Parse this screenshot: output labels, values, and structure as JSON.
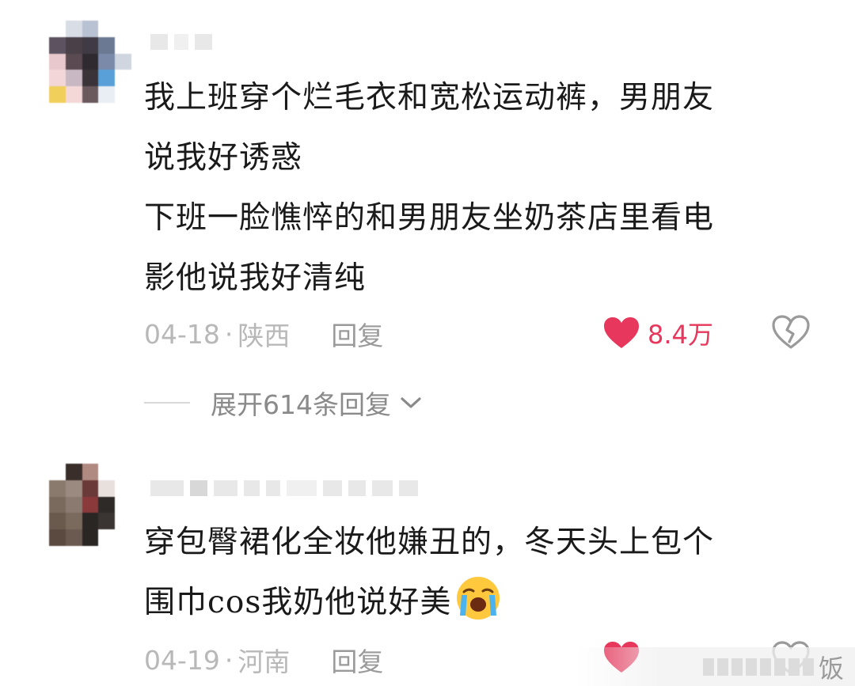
{
  "comments": [
    {
      "lines": [
        "我上班穿个烂毛衣和宽松运动裤，男朋友",
        "说我好诱惑",
        "下班一脸憔悴的和男朋友坐奶茶店里看电",
        "影他说我好清纯"
      ],
      "date": "04-18",
      "dot": "·",
      "location": "陕西",
      "reply_label": "回复",
      "like_count": "8.4万",
      "expand_label": "展开614条回复"
    },
    {
      "lines": [
        "穿包臀裙化全妆他嫌丑的，冬天头上包个",
        "围巾cos我奶他说好美"
      ],
      "emoji": "crying-face-emoji",
      "date": "04-19",
      "dot": "·",
      "location": "河南",
      "reply_label": "回复",
      "like_count": ""
    }
  ],
  "watermark": {
    "text": "饭"
  },
  "colors": {
    "like_red": "#e8375c",
    "meta_gray": "#b8b8b8",
    "text_black": "#1a1a1a"
  },
  "icons": {
    "like": "heart-icon",
    "dislike": "broken-heart-icon",
    "expand": "chevron-down-icon"
  }
}
